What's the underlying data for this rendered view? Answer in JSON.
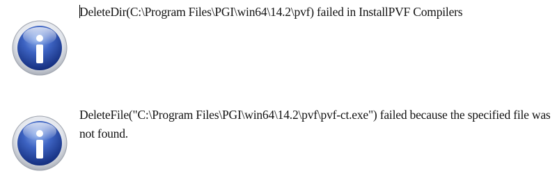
{
  "messages": [
    {
      "icon": "info-icon",
      "text": "DeleteDir(C:\\Program Files\\PGI\\win64\\14.2\\pvf) failed in InstallPVF Compilers"
    },
    {
      "icon": "info-icon",
      "text": "DeleteFile(\"C:\\Program Files\\PGI\\win64\\14.2\\pvf\\pvf-ct.exe\") failed because the specified file was not found."
    }
  ],
  "colors": {
    "icon_blue_dark": "#1e3f9c",
    "icon_blue_light": "#5b86d8",
    "icon_ring": "#c9ccd3",
    "text": "#111111"
  }
}
